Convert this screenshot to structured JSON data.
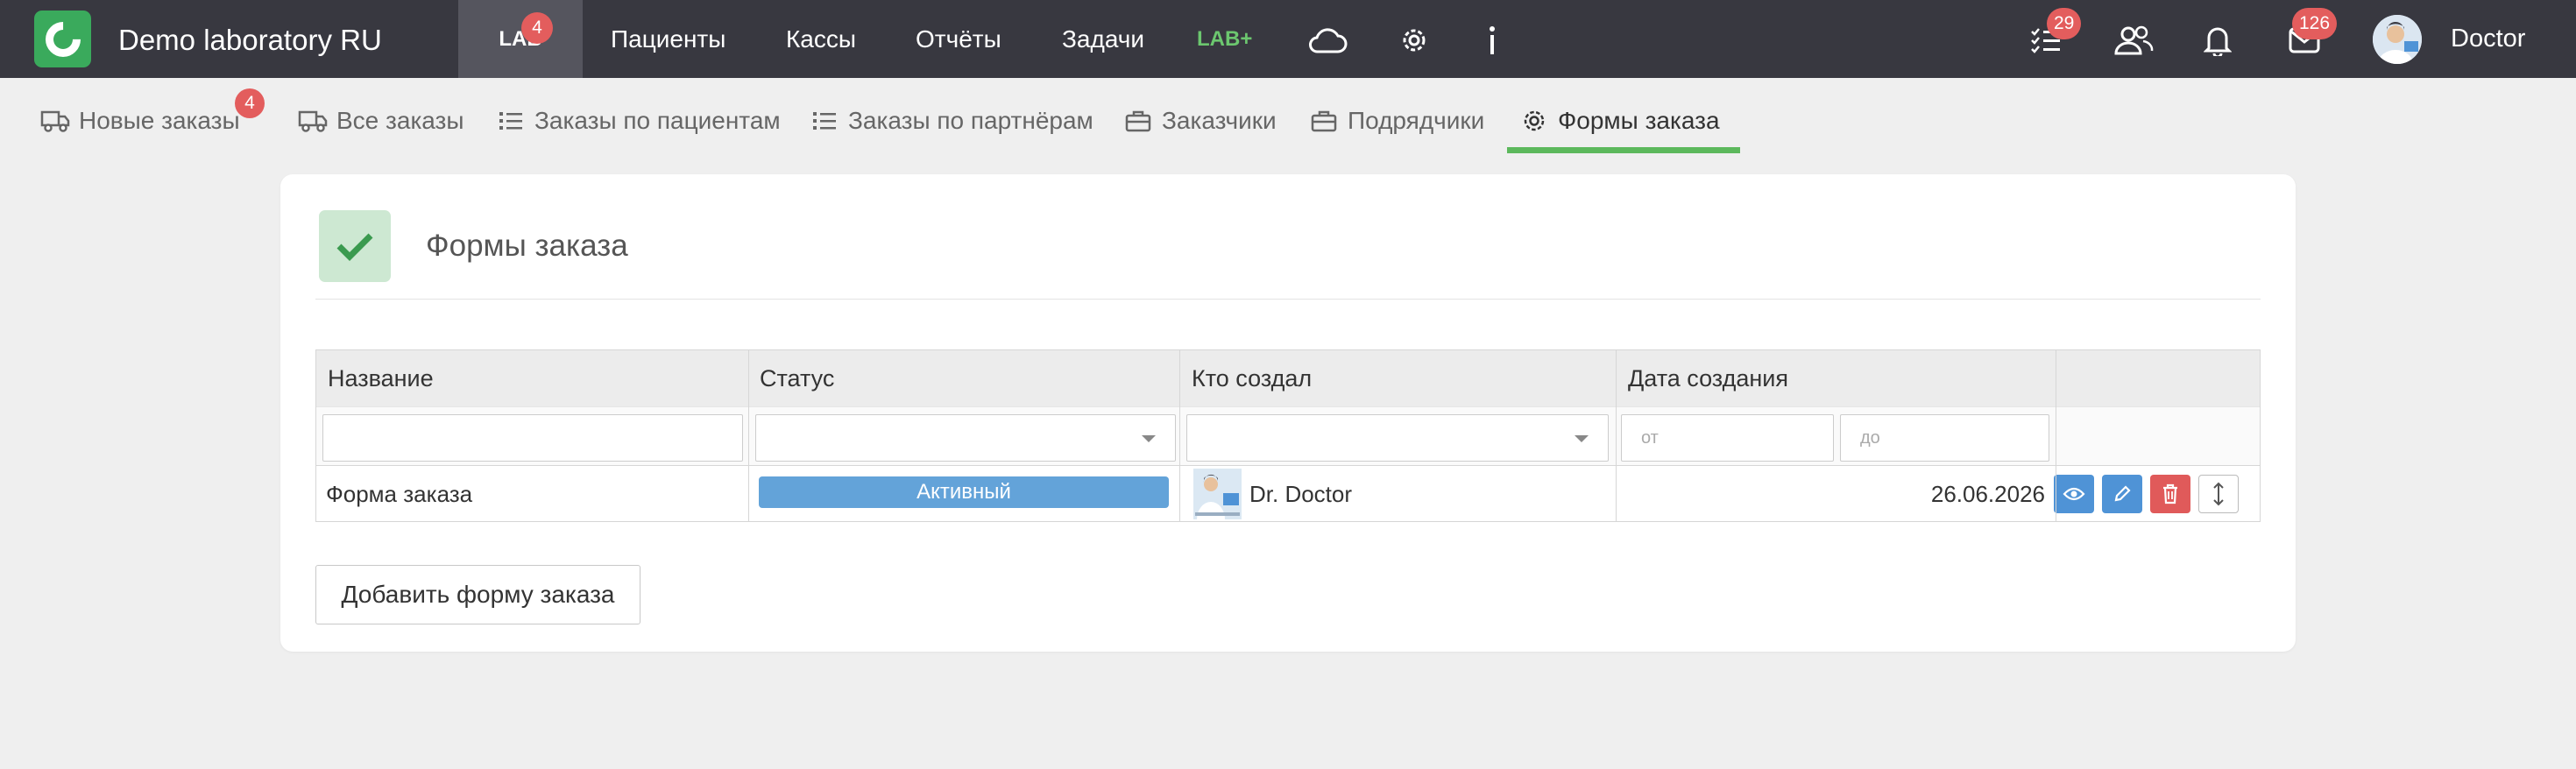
{
  "app": {
    "name": "Demo laboratory RU"
  },
  "topnav": {
    "lab_label": "LAB",
    "lab_badge": "4",
    "items": [
      "Пациенты",
      "Кассы",
      "Отчёты",
      "Задачи"
    ],
    "labplus_label": "LAB+",
    "tasks_badge": "29",
    "mail_badge": "126",
    "user_name": "Doctor"
  },
  "icons": {
    "cloud": "cloud-icon",
    "settings": "gear-icon",
    "info": "info-icon",
    "tasks": "checklist-icon",
    "users": "users-icon",
    "notifications": "bell-icon",
    "mail": "mail-icon"
  },
  "subnav": {
    "items": [
      {
        "label": "Новые заказы",
        "icon": "truck-icon",
        "badge": "4"
      },
      {
        "label": "Все заказы",
        "icon": "truck-icon"
      },
      {
        "label": "Заказы по пациентам",
        "icon": "list-icon"
      },
      {
        "label": "Заказы по партнёрам",
        "icon": "list-icon"
      },
      {
        "label": "Заказчики",
        "icon": "briefcase-icon"
      },
      {
        "label": "Подрядчики",
        "icon": "briefcase-icon"
      },
      {
        "label": "Формы заказа",
        "icon": "gear-icon",
        "active": true
      }
    ]
  },
  "page": {
    "title": "Формы заказа",
    "add_button": "Добавить форму заказа"
  },
  "table": {
    "columns": [
      "Название",
      "Статус",
      "Кто создал",
      "Дата создания"
    ],
    "filters": {
      "date_from_placeholder": "от",
      "date_to_placeholder": "до"
    },
    "rows": [
      {
        "name": "Форма заказа",
        "status": "Активный",
        "creator": "Dr. Doctor",
        "created": "26.06.2026"
      }
    ]
  },
  "colors": {
    "topbar": "#383840",
    "accent_green": "#5cb85c",
    "badge_red": "#e35d5d",
    "status_blue": "#63a3d9",
    "action_blue": "#4f93d6",
    "action_red": "#e05a5a"
  }
}
